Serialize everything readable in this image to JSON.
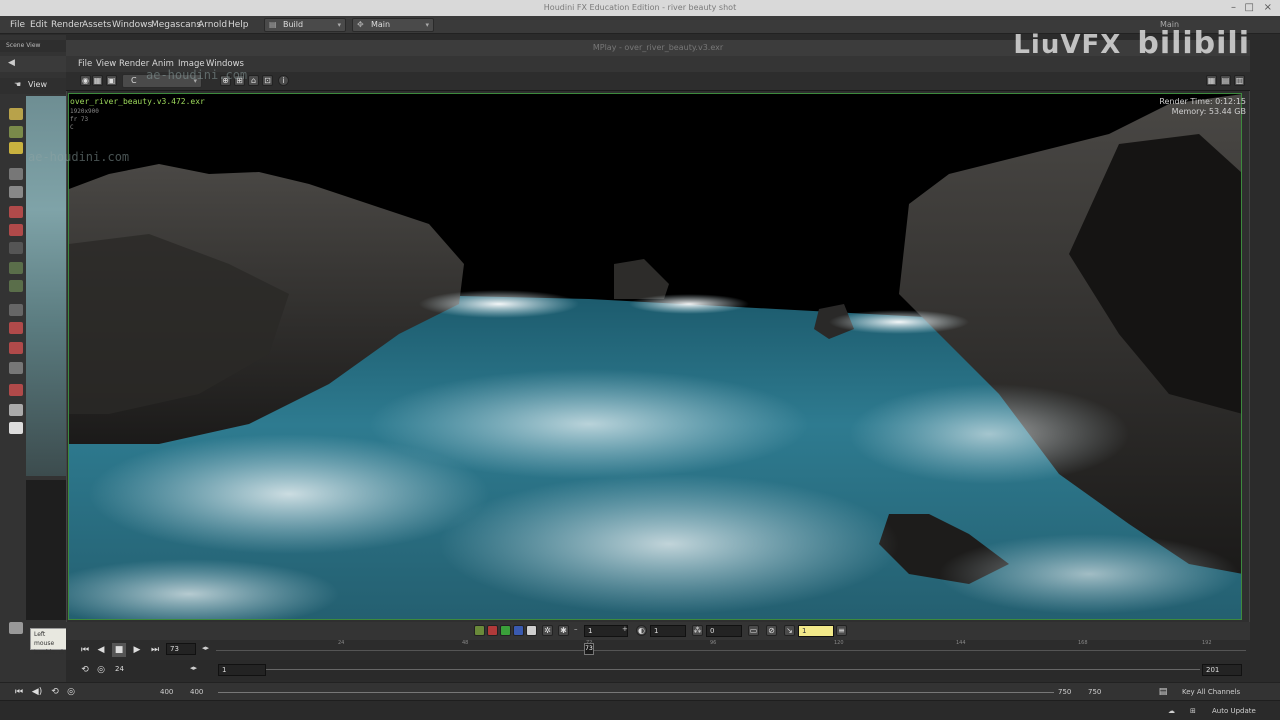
{
  "window": {
    "title": "Houdini FX Education Edition - river beauty shot",
    "minimize": "–",
    "maximize": "□",
    "close": "×"
  },
  "menubar": {
    "items": [
      "File",
      "Edit",
      "Render",
      "Assets",
      "Windows",
      "Megascans",
      "Arnold",
      "Help"
    ],
    "build_label": "Build",
    "desk_label": "Main",
    "right_label": "Main"
  },
  "left_panel": {
    "tab": "Scene View",
    "view_tab": "View",
    "tooltip_line1": "Left mouse",
    "tooltip_line2": "tumble, dr"
  },
  "mplay": {
    "title": "MPlay - over_river_beauty.v3.exr",
    "menu": [
      "File",
      "View",
      "Render",
      "Anim",
      "Image",
      "Windows"
    ],
    "channel": "C",
    "image_name": "over_river_beauty.v3.472.exr",
    "resolution": "1920x900",
    "frame_label": "fr 73",
    "channel_small": "C",
    "render_time": "Render Time: 0:12:15",
    "memory": "Memory:    53.44 GB"
  },
  "overlay": {
    "watermark": "LiuVFX",
    "watermark2": "bilibili",
    "site": "ae-houdini.com"
  },
  "controls": {
    "field1": "1",
    "field2": "1",
    "field3": "0",
    "field4": "1"
  },
  "timeline": {
    "current_frame": "73",
    "marker": "73",
    "fps": "24",
    "start": "1",
    "end": "201",
    "ticks": [
      "24",
      "48",
      "72",
      "96",
      "120",
      "144",
      "168",
      "192"
    ]
  },
  "bottom": {
    "left_a": "400",
    "left_b": "400",
    "right_a": "750",
    "right_b": "750",
    "key_channels": "Key All Channels",
    "auto_update": "Auto Update"
  }
}
